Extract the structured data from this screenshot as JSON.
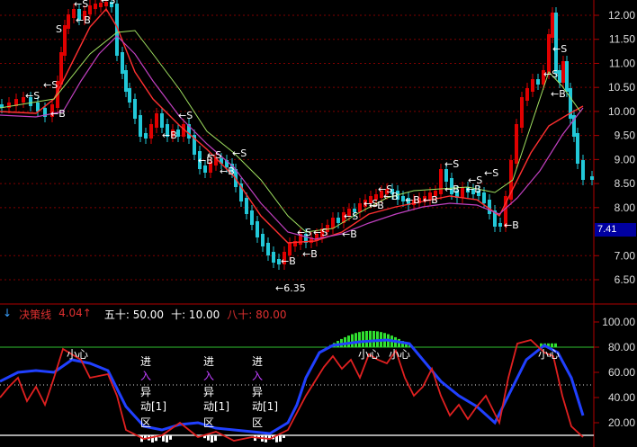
{
  "price_axis": [
    "12.00",
    "11.50",
    "11.00",
    "10.50",
    "10.00",
    "9.50",
    "9.00",
    "8.50",
    "8.00",
    "7.41",
    "7.00",
    "6.50"
  ],
  "current_price": "7.41",
  "low_label": "←6.35",
  "signal_S": "S",
  "signal_B": "B",
  "arrow_left": "←",
  "indicator_bar": {
    "arrow": "↓",
    "name": "决策线",
    "value": "4.04",
    "value_arrow": "↑",
    "fifty_label": "五十: 50.00",
    "ten_label": "十: 10.00",
    "eighty_label": "八十: 80.00"
  },
  "osc_axis": [
    "100.00",
    "80.00",
    "60.00",
    "40.00",
    "20.00"
  ],
  "osc_notes": {
    "small_heart": "小心",
    "enter1": "进",
    "enter2": "入",
    "abn1": "异",
    "abn2": "动[1]",
    "zone": "区"
  },
  "colors": {
    "bg": "#000000",
    "up_candle": "#e00000",
    "down_candle": "#22c8d8",
    "ma_red": "#ff3030",
    "ma_magenta": "#c040c0",
    "ma_green": "#a0e060",
    "osc_blue": "#2040ff",
    "osc_red": "#e02020",
    "osc_green_fill": "#30e030",
    "grid": "#800000"
  }
}
